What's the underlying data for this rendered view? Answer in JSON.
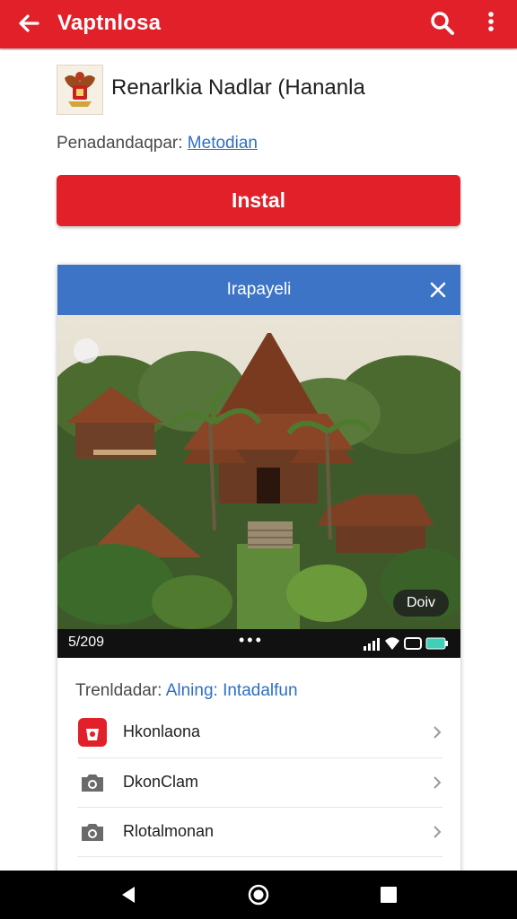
{
  "appbar": {
    "title": "Vaptnlosa",
    "back_icon": "back-arrow-icon",
    "search_icon": "search-icon",
    "more_icon": "more-vert-icon",
    "color": "#e2202a"
  },
  "app": {
    "name": "Renarlkia Nadlar (Hananla",
    "developer_label": "Penadandaqpar:",
    "developer_link": "Metodian",
    "install_label": "Instal"
  },
  "card": {
    "header_title": "Irapayeli",
    "close_icon": "close-icon",
    "header_color": "#3d74c6",
    "image_badge": "Doiv",
    "status": {
      "time": "5/209",
      "dots": "•••"
    },
    "section_label": "Trenldadar:",
    "section_link": "Alning: Intadalfun",
    "items": [
      {
        "label": "Hkonlaona",
        "icon": "app-red-icon"
      },
      {
        "label": "DkonClam",
        "icon": "camera-icon"
      },
      {
        "label": "Rlotalmonan",
        "icon": "camera-icon"
      }
    ]
  },
  "navbar": {
    "back": "nav-back-icon",
    "home": "nav-home-icon",
    "recents": "nav-recents-icon"
  }
}
